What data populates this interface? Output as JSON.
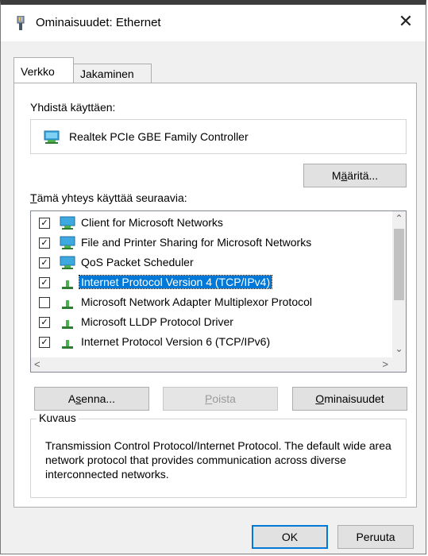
{
  "window": {
    "title": "Ominaisuudet: Ethernet",
    "close_glyph": "✕"
  },
  "tabs": [
    {
      "label": "Verkko",
      "active": true
    },
    {
      "label": "Jakaminen",
      "active": false
    }
  ],
  "connect_using": {
    "label": "Yhdistä käyttäen:",
    "adapter_name": "Realtek PCIe GBE Family Controller",
    "configure_button": {
      "pre": "M",
      "accel": "ä",
      "post": "äritä..."
    }
  },
  "items_section": {
    "label_accel": "T",
    "label_rest": "ämä yhteys käyttää seuraavia:",
    "items": [
      {
        "label": "Client for Microsoft Networks",
        "checked": true,
        "icon": "network-client-icon",
        "selected": false
      },
      {
        "label": "File and Printer Sharing for Microsoft Networks",
        "checked": true,
        "icon": "network-service-icon",
        "selected": false
      },
      {
        "label": "QoS Packet Scheduler",
        "checked": true,
        "icon": "network-service-icon",
        "selected": false
      },
      {
        "label": "Internet Protocol Version 4 (TCP/IPv4)",
        "checked": true,
        "icon": "protocol-icon",
        "selected": true
      },
      {
        "label": "Microsoft Network Adapter Multiplexor Protocol",
        "checked": false,
        "icon": "protocol-icon",
        "selected": false
      },
      {
        "label": "Microsoft LLDP Protocol Driver",
        "checked": true,
        "icon": "protocol-icon",
        "selected": false
      },
      {
        "label": "Internet Protocol Version 6 (TCP/IPv6)",
        "checked": true,
        "icon": "protocol-icon",
        "selected": false
      }
    ]
  },
  "actions": {
    "install": {
      "pre": "A",
      "accel": "s",
      "post": "enna..."
    },
    "uninstall": {
      "pre": "",
      "accel": "P",
      "post": "oista"
    },
    "properties": {
      "pre": "",
      "accel": "O",
      "post": "minaisuudet"
    }
  },
  "description": {
    "title": "Kuvaus",
    "text": "Transmission Control Protocol/Internet Protocol. The default wide area network protocol that provides communication across diverse interconnected networks."
  },
  "footer": {
    "ok": "OK",
    "cancel": "Peruuta"
  },
  "colors": {
    "selection": "#0078d7",
    "dialog_bg": "#f0f0f0",
    "button_bg": "#e1e1e1"
  }
}
